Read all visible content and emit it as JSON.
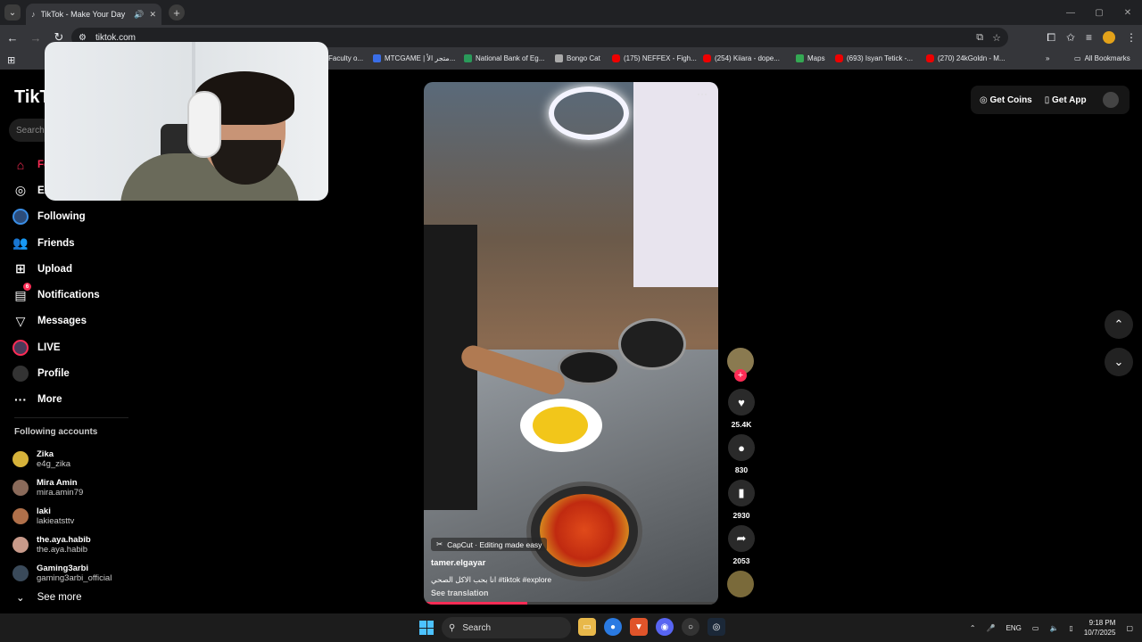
{
  "browser": {
    "tab_title": "TikTok - Make Your Day",
    "url": "tiktok.com"
  },
  "bookmarks": [
    "Faculty o...",
    "MTCGAME | متجر الأ...",
    "National Bank of Eg...",
    "Bongo Cat",
    "(175) NEFFEX - Figh...",
    "(254) Kiiara - dope...",
    "Maps",
    "(693) Isyan Tetick -...",
    "(270) 24kGoldn - M...",
    "All Bookmarks"
  ],
  "sidebar": {
    "logo": "TikTok",
    "search_placeholder": "Search",
    "nav": [
      "For You",
      "Explore",
      "Following",
      "Friends",
      "Upload",
      "Notifications",
      "Messages",
      "LIVE",
      "Profile",
      "More"
    ],
    "notifications_badge": "6",
    "following_title": "Following accounts",
    "following": [
      {
        "name": "Zika",
        "handle": "e4g_zika"
      },
      {
        "name": "Mira Amin",
        "handle": "mira.amin79"
      },
      {
        "name": "laki",
        "handle": "lakieatsttv"
      },
      {
        "name": "the.aya.habib",
        "handle": "the.aya.habib"
      },
      {
        "name": "Gaming3arbi",
        "handle": "gaming3arbi_official"
      }
    ],
    "see_more": "See more"
  },
  "video": {
    "capcut_label": "CapCut · Editing made easy",
    "author": "tamer.elgayar",
    "description": "انا بحب الاكل الصحي #tiktok #explore",
    "see_translation": "See translation",
    "progress": 0.35
  },
  "actions": {
    "likes": "25.4K",
    "comments": "830",
    "saves": "2930",
    "shares": "2053"
  },
  "topbar": {
    "get_coins": "Get Coins",
    "get_app": "Get App"
  },
  "taskbar": {
    "search": "Search",
    "lang": "ENG",
    "time": "9:18 PM",
    "date": "10/7/2025"
  },
  "colors": {
    "accent": "#fe2c55"
  }
}
